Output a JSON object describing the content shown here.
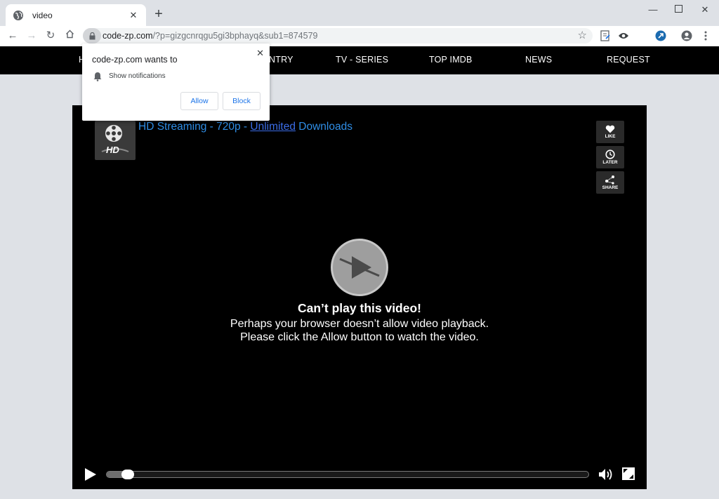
{
  "browser": {
    "tab_title": "video",
    "url_host": "code-zp.com",
    "url_path": "/?p=gizgcnrqgu5gi3bphayq&sub1=874579"
  },
  "permission_prompt": {
    "title": "code-zp.com wants to",
    "permission": "Show notifications",
    "allow_label": "Allow",
    "block_label": "Block"
  },
  "site_nav": {
    "items": [
      "H",
      "NTRY",
      "TV - SERIES",
      "TOP IMDB",
      "NEWS",
      "REQUEST"
    ]
  },
  "player": {
    "title_prefix": "HD Streaming - 720p - ",
    "title_link": "Unlimited",
    "title_suffix": " Downloads",
    "logo_text": "HD",
    "side_buttons": [
      "LIKE",
      "LATER",
      "SHARE"
    ],
    "error_heading": "Can’t play this video!",
    "error_body": "Perhaps your browser doesn’t allow video playback. Please click the Allow button to watch the video.",
    "progress_fraction": 0.03
  },
  "colors": {
    "title_blue": "#2f8ee6",
    "link_blue": "#3b6de8",
    "button_blue": "#1a73e8"
  },
  "icons": [
    "globe-icon",
    "close-icon",
    "plus-icon",
    "minimize-icon",
    "maximize-icon",
    "back-icon",
    "forward-icon",
    "reload-icon",
    "home-icon",
    "lock-icon",
    "star-icon",
    "extension-icon",
    "profile-icon",
    "menu-icon",
    "bell-icon",
    "heart-icon",
    "clock-icon",
    "share-icon",
    "play-icon",
    "volume-icon",
    "fullscreen-icon"
  ]
}
